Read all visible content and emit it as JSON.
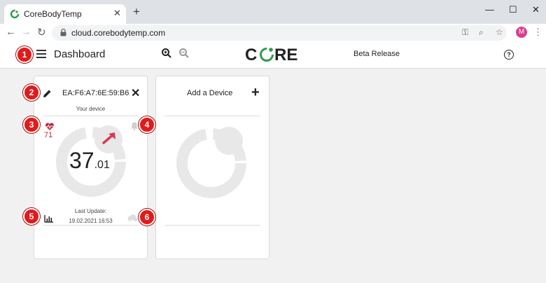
{
  "browser": {
    "tab_title": "CoreBodyTemp",
    "url": "cloud.corebodytemp.com",
    "profile_initial": "M"
  },
  "header": {
    "title": "Dashboard",
    "logo_text": "CORE",
    "beta_label": "Beta Release"
  },
  "device_card": {
    "device_id": "EA:F6:A7:6E:59:B6",
    "subtitle": "Your device",
    "heart_rate": "71",
    "temp_int": "37",
    "temp_dec": ".01",
    "last_update_label": "Last Update:",
    "last_update_value": "19.02.2021 16:53"
  },
  "add_card": {
    "label": "Add a Device"
  },
  "callouts": [
    "1",
    "2",
    "3",
    "4",
    "5",
    "6"
  ],
  "colors": {
    "accent_red": "#c0283a",
    "logo_green": "#2e9b4a",
    "badge_red": "#e01b1b"
  }
}
